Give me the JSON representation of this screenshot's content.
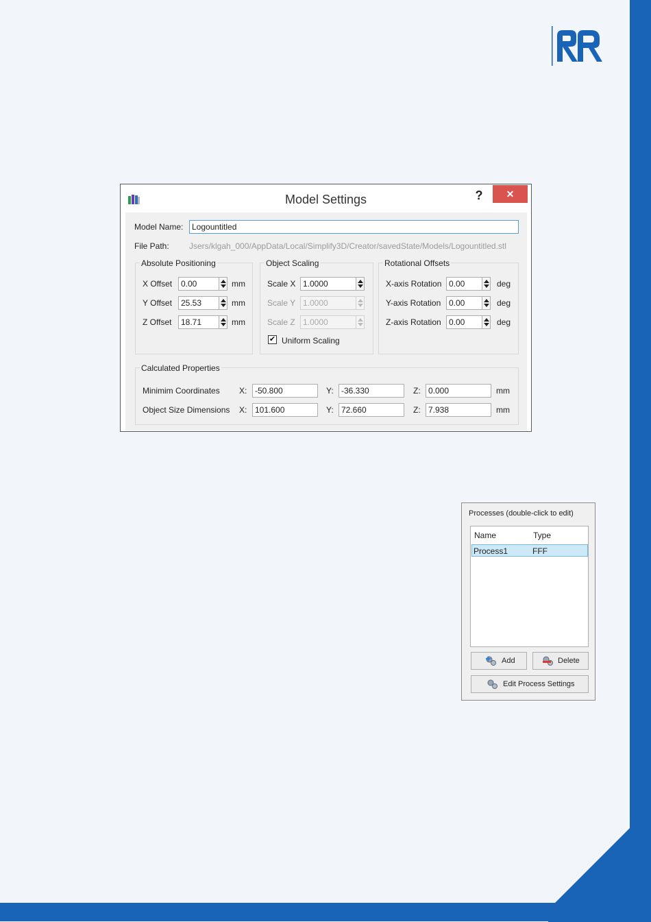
{
  "dialog": {
    "title": "Model Settings",
    "help": "?",
    "close": "✕",
    "model_name_label": "Model Name:",
    "model_name_value": "Logountitled",
    "file_path_label": "File Path:",
    "file_path_value": "Jsers/klgah_000/AppData/Local/Simplify3D/Creator/savedState/Models/Logountitled.stl",
    "absolute_positioning": {
      "title": "Absolute Positioning",
      "rows": [
        {
          "label": "X Offset",
          "value": "0.00",
          "unit": "mm"
        },
        {
          "label": "Y Offset",
          "value": "25.53",
          "unit": "mm"
        },
        {
          "label": "Z Offset",
          "value": "18.71",
          "unit": "mm"
        }
      ]
    },
    "object_scaling": {
      "title": "Object Scaling",
      "rows": [
        {
          "label": "Scale X",
          "value": "1.0000"
        },
        {
          "label": "Scale Y",
          "value": "1.0000"
        },
        {
          "label": "Scale Z",
          "value": "1.0000"
        }
      ],
      "uniform_label": "Uniform Scaling",
      "uniform_checked": "✔"
    },
    "rotational_offsets": {
      "title": "Rotational Offsets",
      "rows": [
        {
          "label": "X-axis Rotation",
          "value": "0.00",
          "unit": "deg"
        },
        {
          "label": "Y-axis Rotation",
          "value": "0.00",
          "unit": "deg"
        },
        {
          "label": "Z-axis Rotation",
          "value": "0.00",
          "unit": "deg"
        }
      ]
    },
    "calculated": {
      "title": "Calculated Properties",
      "rows": [
        {
          "label": "Minimim Coordinates",
          "x_label": "X:",
          "x": "-50.800",
          "y_label": "Y:",
          "y": "-36.330",
          "z_label": "Z:",
          "z": "0.000",
          "unit": "mm"
        },
        {
          "label": "Object Size Dimensions",
          "x_label": "X:",
          "x": "101.600",
          "y_label": "Y:",
          "y": "72.660",
          "z_label": "Z:",
          "z": "7.938",
          "unit": "mm"
        }
      ]
    }
  },
  "processes": {
    "title": "Processes (double-click to edit)",
    "columns": [
      "Name",
      "Type"
    ],
    "rows": [
      {
        "name": "Process1",
        "type": "FFF"
      }
    ],
    "add_label": "Add",
    "delete_label": "Delete",
    "edit_label": "Edit Process Settings"
  },
  "colors": {
    "brand_blue": "#1a64b7",
    "close_red": "#d9534f",
    "selection": "#cde8f6"
  },
  "icons": [
    "app-icon",
    "help-icon",
    "close-icon",
    "spin-arrows-icon",
    "checkmark-icon",
    "add-process-icon",
    "delete-process-icon",
    "edit-settings-icon",
    "brand-logo"
  ]
}
